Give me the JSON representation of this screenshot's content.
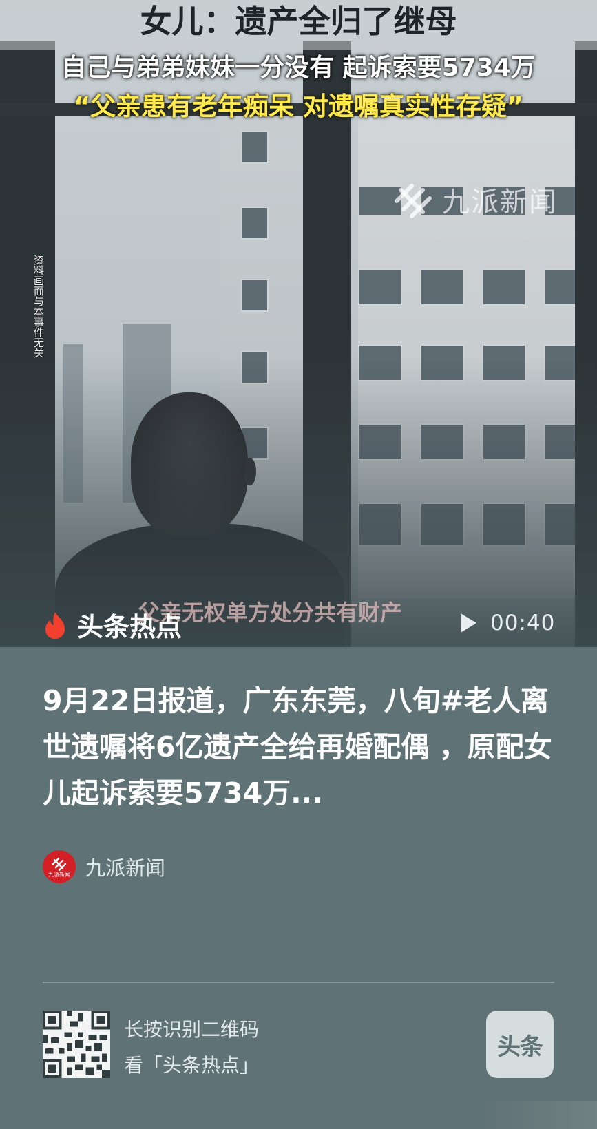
{
  "video": {
    "overlay_title": "女儿：遗产全归了继母",
    "overlay_subtitle": "自己与弟弟妹妹一分没有 起诉索要5734万",
    "overlay_quote": "“父亲患有老年痴呆 对遗嘱真实性存疑”",
    "side_note": "资料画面与本事件无关",
    "watermark": "九派新闻",
    "caption": "父亲无权单方处分共有财产"
  },
  "player": {
    "topic_label": "头条热点",
    "duration": "00:40"
  },
  "article": {
    "headline": "9月22日报道，广东东莞，八旬#老人离世遗嘱将6亿遗产全给再婚配偶 ，原配女儿起诉索要5734万...",
    "source_name": "九派新闻",
    "source_logo_text": "九派新闻"
  },
  "footer": {
    "qr_hint": "长按识别二维码",
    "qr_action": "看「头条热点」",
    "app_badge": "头条"
  }
}
